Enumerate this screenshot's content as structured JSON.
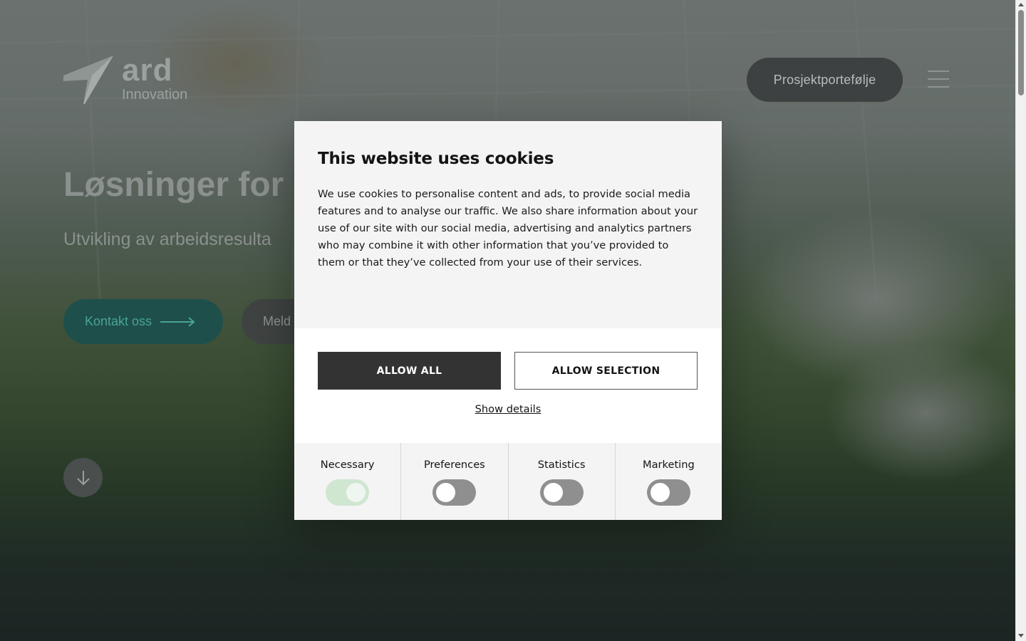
{
  "header": {
    "logo_word": "ard",
    "logo_sub": "Innovation",
    "portfolio_button": "Prosjektportefølje",
    "menu_icon": "hamburger-menu-icon"
  },
  "hero": {
    "title": "Løsninger for",
    "subtitle": "Utvikling av arbeidsresulta",
    "contact_button": "Kontakt oss",
    "secondary_button": "Meld",
    "scroll_icon": "arrow-down-icon"
  },
  "cookie": {
    "title": "This website uses cookies",
    "text": "We use cookies to personalise content and ads, to provide social media features and to analyse our traffic. We also share information about your use of our site with our social media, advertising and analytics partners who may combine it with other information that you’ve provided to them or that they’ve collected from your use of their services.",
    "allow_all": "ALLOW ALL",
    "allow_selection": "ALLOW SELECTION",
    "show_details": "Show details",
    "categories": [
      {
        "label": "Necessary",
        "enabled": true
      },
      {
        "label": "Preferences",
        "enabled": false
      },
      {
        "label": "Statistics",
        "enabled": false
      },
      {
        "label": "Marketing",
        "enabled": false
      }
    ]
  },
  "colors": {
    "accent_teal": "#1e4f4b",
    "dialog_bg": "#f4f4f4",
    "primary_button": "#333333"
  }
}
